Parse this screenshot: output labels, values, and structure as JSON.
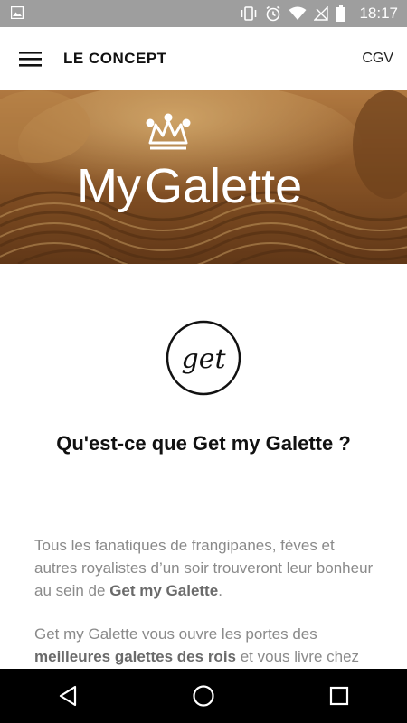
{
  "status_bar": {
    "time": "18:17",
    "icons": [
      "image-icon",
      "vibrate-icon",
      "alarm-icon",
      "wifi-icon",
      "no-signal-icon",
      "battery-icon"
    ]
  },
  "app_bar": {
    "title": "LE CONCEPT",
    "cgv": "CGV",
    "menu_icon": "hamburger-menu-icon"
  },
  "hero": {
    "logo_text_thin": "My",
    "logo_text_main": "Galette",
    "crown_icon": "crown-icon"
  },
  "badge": {
    "text": "get"
  },
  "content": {
    "question": "Qu'est-ce que Get my Galette ?",
    "p1_text_1": "Tous les fanatiques de frangipanes, fèves et autres royalistes d’un soir trouveront leur bonheur au sein de ",
    "p1_bold": "Get my Galette",
    "p1_text_2": ".",
    "p2_text_1": "Get my Galette vous ouvre les portes des ",
    "p2_bold": "meilleures galettes des rois",
    "p2_text_2": " et vous livre chez"
  },
  "nav_bar": {
    "icons": [
      "back-icon",
      "home-icon",
      "recents-icon"
    ]
  }
}
